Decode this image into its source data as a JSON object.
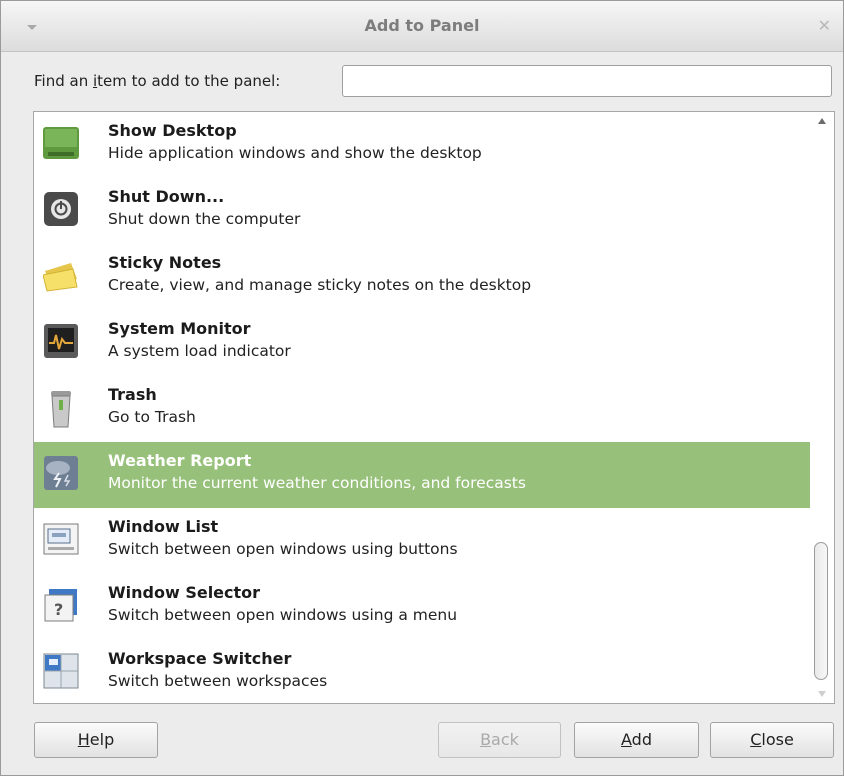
{
  "window": {
    "title": "Add to Panel"
  },
  "find": {
    "label_prefix": "Find an ",
    "label_mnemonic": "i",
    "label_suffix": "tem to add to the panel:",
    "value": "",
    "placeholder": ""
  },
  "items": [
    {
      "name": "Show Desktop",
      "description": "Hide application windows and show the desktop",
      "icon": "show-desktop-icon",
      "selected": false
    },
    {
      "name": "Shut Down...",
      "description": "Shut down the computer",
      "icon": "power-icon",
      "selected": false
    },
    {
      "name": "Sticky Notes",
      "description": "Create, view, and manage sticky notes on the desktop",
      "icon": "sticky-notes-icon",
      "selected": false
    },
    {
      "name": "System Monitor",
      "description": "A system load indicator",
      "icon": "system-monitor-icon",
      "selected": false
    },
    {
      "name": "Trash",
      "description": "Go to Trash",
      "icon": "trash-icon",
      "selected": false
    },
    {
      "name": "Weather Report",
      "description": "Monitor the current weather conditions, and forecasts",
      "icon": "weather-icon",
      "selected": true
    },
    {
      "name": "Window List",
      "description": "Switch between open windows using buttons",
      "icon": "window-list-icon",
      "selected": false
    },
    {
      "name": "Window Selector",
      "description": "Switch between open windows using a menu",
      "icon": "window-selector-icon",
      "selected": false
    },
    {
      "name": "Workspace Switcher",
      "description": "Switch between workspaces",
      "icon": "workspace-switcher-icon",
      "selected": false
    }
  ],
  "buttons": {
    "help": {
      "mnemonic": "H",
      "rest": "elp"
    },
    "back": {
      "mnemonic": "B",
      "rest": "ack",
      "disabled": true
    },
    "add": {
      "mnemonic": "A",
      "rest": "dd"
    },
    "close": {
      "mnemonic": "C",
      "rest": "lose"
    }
  },
  "colors": {
    "selection": "#97c07a",
    "background": "#ececec"
  }
}
